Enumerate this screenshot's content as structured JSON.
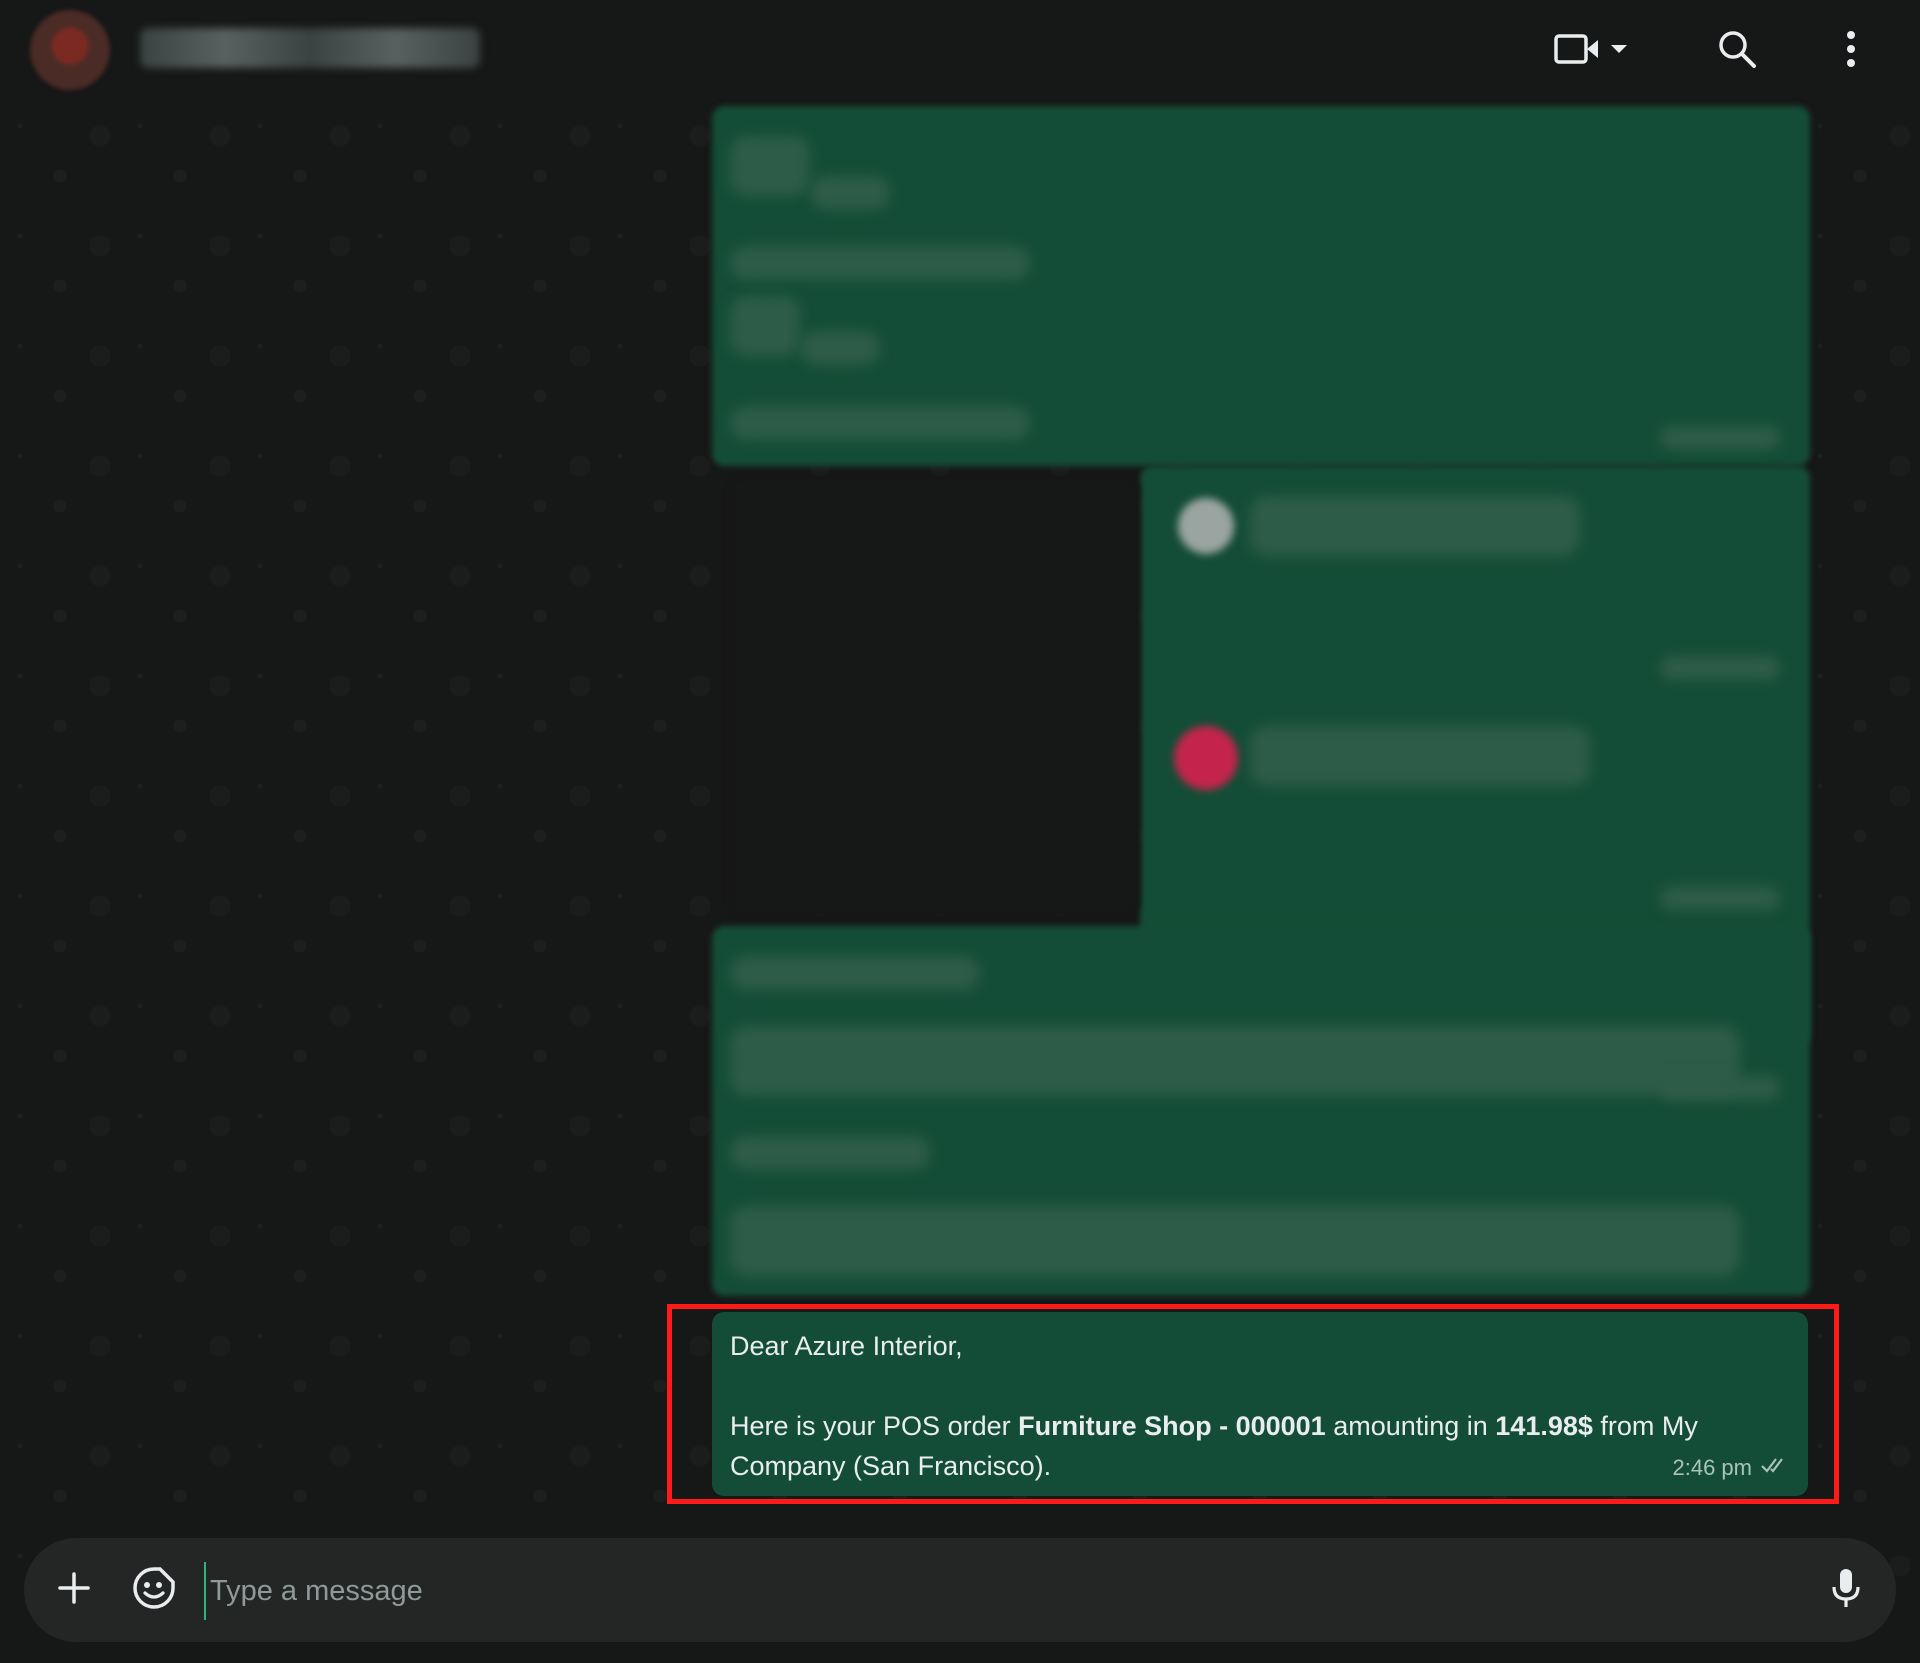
{
  "header": {
    "contact_name": "",
    "icons": {
      "video": "video-camera-icon",
      "dropdown": "chevron-down-icon",
      "search": "search-icon",
      "menu": "more-vertical-icon"
    }
  },
  "message": {
    "greeting": "Dear Azure Interior,",
    "body_prefix": "Here is your POS order ",
    "order_name": "Furniture Shop - 000001",
    "body_mid": " amounting in ",
    "amount": "141.98$",
    "body_suffix": " from My",
    "body_line2": "Company (San Francisco).",
    "time": "2:46 pm",
    "status_icon": "double-check-icon"
  },
  "composer": {
    "placeholder": "Type a message",
    "value": ""
  },
  "colors": {
    "header_bg": "#161717",
    "bubble_outgoing": "#144d37",
    "highlight": "#ff1a1a",
    "composer_bg": "#242626",
    "accent": "#2fb47c"
  }
}
